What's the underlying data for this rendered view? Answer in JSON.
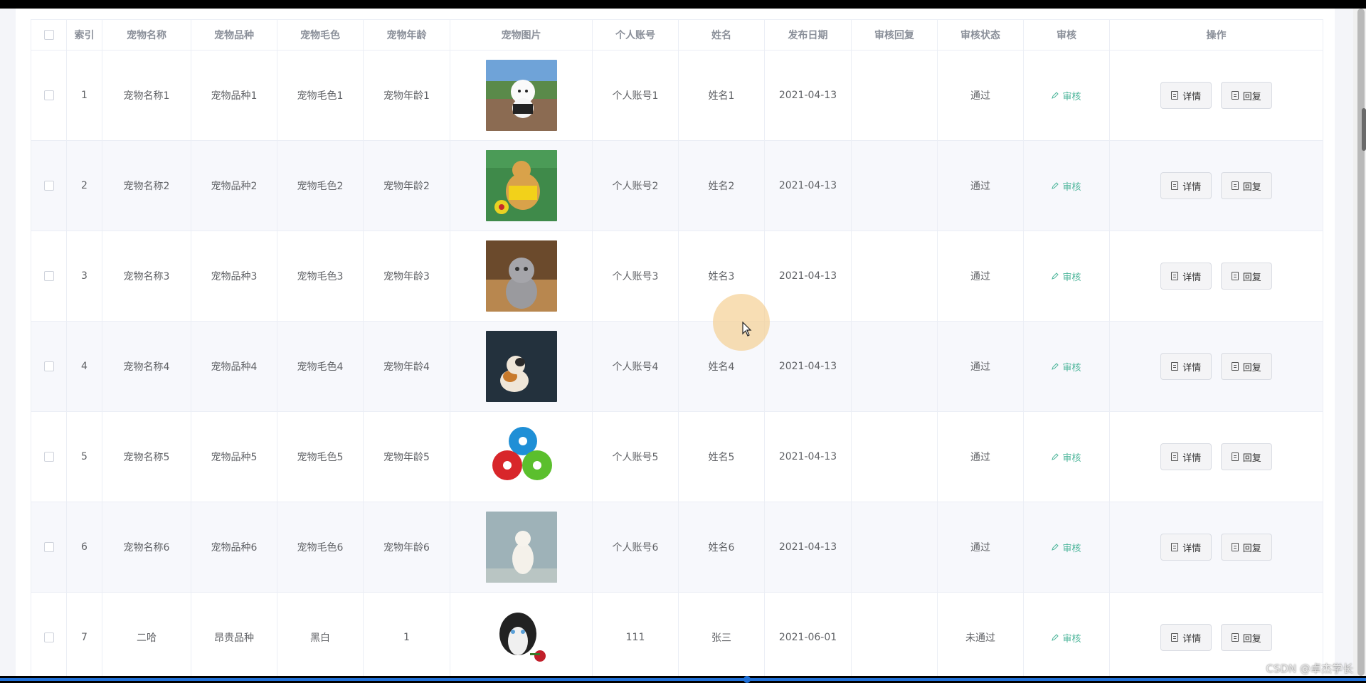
{
  "table": {
    "headers": [
      "索引",
      "宠物名称",
      "宠物品种",
      "宠物毛色",
      "宠物年龄",
      "宠物图片",
      "个人账号",
      "姓名",
      "发布日期",
      "审核回复",
      "审核状态",
      "审核",
      "操作"
    ],
    "rows": [
      {
        "index": "1",
        "name": "宠物名称1",
        "breed": "宠物品种1",
        "color": "宠物毛色1",
        "age": "宠物年龄1",
        "account": "个人账号1",
        "person": "姓名1",
        "date": "2021-04-13",
        "reply": "",
        "status": "通过",
        "image": "white-poodle-photo"
      },
      {
        "index": "2",
        "name": "宠物名称2",
        "breed": "宠物品种2",
        "color": "宠物毛色2",
        "age": "宠物年龄2",
        "account": "个人账号2",
        "person": "姓名2",
        "date": "2021-04-13",
        "reply": "",
        "status": "通过",
        "image": "golden-dog-with-ball-photo"
      },
      {
        "index": "3",
        "name": "宠物名称3",
        "breed": "宠物品种3",
        "color": "宠物毛色3",
        "age": "宠物年龄3",
        "account": "个人账号3",
        "person": "姓名3",
        "date": "2021-04-13",
        "reply": "",
        "status": "通过",
        "image": "grey-kitten-photo"
      },
      {
        "index": "4",
        "name": "宠物名称4",
        "breed": "宠物品种4",
        "color": "宠物毛色4",
        "age": "宠物年龄4",
        "account": "个人账号4",
        "person": "姓名4",
        "date": "2021-04-13",
        "reply": "",
        "status": "通过",
        "image": "calico-kitten-photo"
      },
      {
        "index": "5",
        "name": "宠物名称5",
        "breed": "宠物品种5",
        "color": "宠物毛色5",
        "age": "宠物年龄5",
        "account": "个人账号5",
        "person": "姓名5",
        "date": "2021-04-13",
        "reply": "",
        "status": "通过",
        "image": "toy-balls-photo"
      },
      {
        "index": "6",
        "name": "宠物名称6",
        "breed": "宠物品种6",
        "color": "宠物毛色6",
        "age": "宠物年龄6",
        "account": "个人账号6",
        "person": "姓名6",
        "date": "2021-04-13",
        "reply": "",
        "status": "通过",
        "image": "white-cat-photo"
      },
      {
        "index": "7",
        "name": "二哈",
        "breed": "昂贵品种",
        "color": "黑白",
        "age": "1",
        "account": "111",
        "person": "张三",
        "date": "2021-06-01",
        "reply": "",
        "status": "未通过",
        "image": "husky-with-rose-photo"
      }
    ]
  },
  "actions": {
    "audit_label": "审核",
    "detail_label": "详情",
    "reply_label": "回复"
  },
  "watermark": "CSDN @卓杰学长",
  "colors": {
    "accent_green": "#4cb59a",
    "header_text": "#8a8f99",
    "row_alt_bg": "#f7f8fc",
    "progress_blue": "#1f6fd6"
  }
}
